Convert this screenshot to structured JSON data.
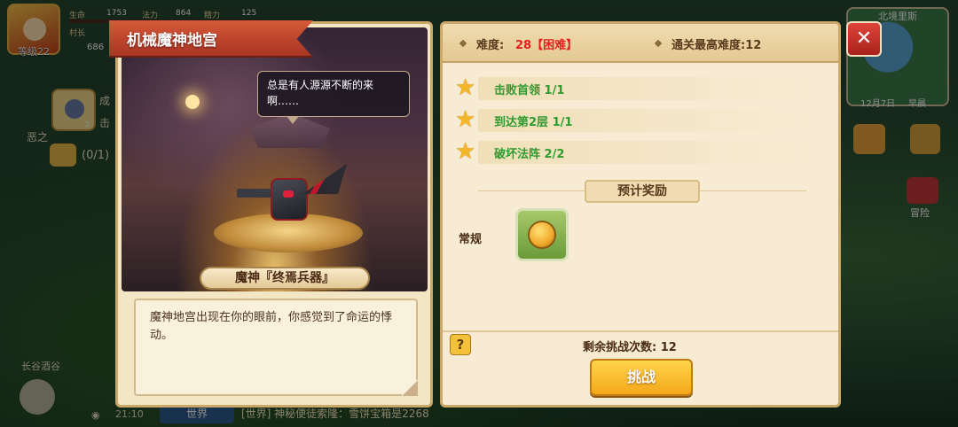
{
  "hud": {
    "level": "等级22",
    "hp_label": "生命",
    "hp_value": "1753",
    "atk_label": "法力",
    "atk_value": "864",
    "spd_label": "精力",
    "spd_value": "125",
    "village": "村长",
    "coins": "686",
    "side_count_badge": "2",
    "side_text_1": "成",
    "side_text_2": "击",
    "side_text_3": "恶之",
    "side_counter": "(0/1)",
    "tavern": "长谷酒谷",
    "time": "21:10",
    "wifi": "◉",
    "chat_channel": "世界",
    "chat_message": "[世界] 神秘便徒索隆：雪饼宝箱是2268",
    "map_title": "北境里斯",
    "map_date": "12月7日",
    "map_period": "早晨",
    "adventure": "冒险"
  },
  "left_panel": {
    "title": "机械魔神地宫",
    "speech": "总是有人源源不断的来啊……",
    "boss_name": "魔神『终焉兵器』",
    "description": "魔神地宫出现在你的眼前，你感觉到了命运的悸动。"
  },
  "right_panel": {
    "difficulty_label": "难度:",
    "difficulty_value": "28【困难】",
    "best_label": "通关最高难度:12",
    "missions": [
      {
        "text": "击败首领  1/1"
      },
      {
        "text": "到达第2层  1/1"
      },
      {
        "text": "破坏法阵  2/2"
      }
    ],
    "reward_title": "预计奖励",
    "normal_label": "常规",
    "help": "?",
    "remaining": "剩余挑战次数: 12",
    "challenge": "挑战"
  },
  "close_label": "✕",
  "colors": {
    "difficulty_red": "#e02020",
    "mission_green": "#2f9a2f",
    "star_gold": "#f4b72a",
    "button_gold": "#f4a81a",
    "close_red": "#c8302a"
  },
  "icons": [
    "star-icon",
    "coin-icon",
    "close-icon",
    "help-icon"
  ]
}
